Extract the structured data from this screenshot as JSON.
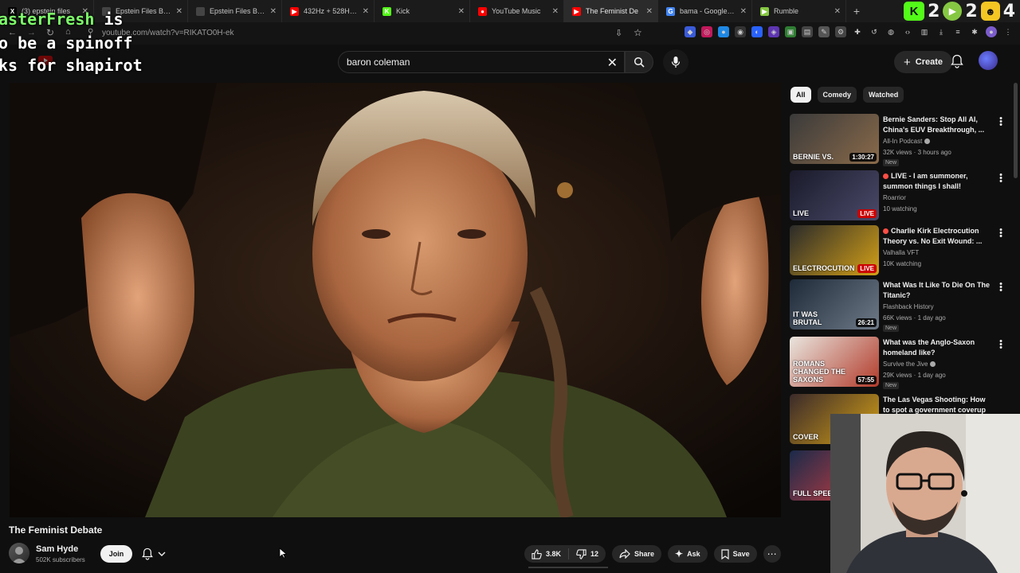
{
  "browser": {
    "tabs": [
      {
        "title": "(3) epstein files",
        "favicon": "x-icon",
        "color": "#000000",
        "glyph": "X"
      },
      {
        "title": "Epstein Files Browser",
        "favicon": "doc-icon",
        "color": "#444444",
        "glyph": ""
      },
      {
        "title": "Epstein Files Browser",
        "favicon": "doc-icon",
        "color": "#444444",
        "glyph": ""
      },
      {
        "title": "432Hz + 528Hz + 7",
        "favicon": "youtube-icon",
        "color": "#ff0000",
        "glyph": "▶"
      },
      {
        "title": "Kick",
        "favicon": "kick-icon",
        "color": "#53fc18",
        "glyph": "K"
      },
      {
        "title": "YouTube Music",
        "favicon": "youtube-music-icon",
        "color": "#ff0000",
        "glyph": "●"
      },
      {
        "title": "The Feminist De",
        "favicon": "youtube-icon",
        "color": "#ff0000",
        "glyph": "▶",
        "active": true
      },
      {
        "title": "bama - Google Sea",
        "favicon": "google-icon",
        "color": "#4285f4",
        "glyph": "G"
      },
      {
        "title": "Rumble",
        "favicon": "rumble-icon",
        "color": "#85c742",
        "glyph": "▶"
      }
    ],
    "url": "youtube.com/watch?v=RIKATO0H-ek",
    "right_badges": {
      "kick_letter": "K",
      "num1": "2",
      "num2": "2",
      "num3": "4"
    }
  },
  "overlay": {
    "line1_prefix": "asterFresh",
    "line1_suffix": " is",
    "line2": "o be a spinoff",
    "line3": "ks for shapirot"
  },
  "search": {
    "query": "baron coleman"
  },
  "header": {
    "create_label": "Create"
  },
  "video": {
    "title": "The Feminist Debate",
    "channel": "Sam Hyde",
    "subscribers": "502K subscribers",
    "join_label": "Join",
    "likes": "3.8K",
    "dislikes": "12",
    "share_label": "Share",
    "ask_label": "Ask",
    "save_label": "Save"
  },
  "chips": [
    "All",
    "Comedy",
    "Watched"
  ],
  "recommendations": [
    {
      "title": "Bernie Sanders: Stop All AI, China's EUV Breakthrough, ...",
      "channel": "All-In Podcast",
      "meta": "32K views · 3 hours ago",
      "badge": "New",
      "duration": "1:30:27",
      "thumb_text": "BERNIE VS.",
      "verified": true
    },
    {
      "title": "LIVE - I am summoner, summon things I shall!",
      "channel": "Roarrior",
      "meta": "10 watching",
      "badge": "",
      "duration": "LIVE",
      "thumb_text": "LIVE",
      "live": true
    },
    {
      "title": "Charlie Kirk Electrocution Theory vs. No Exit Wound: ...",
      "channel": "Valhalla VFT",
      "meta": "10K watching",
      "badge": "",
      "duration": "LIVE",
      "thumb_text": "ELECTROCUTION",
      "live": true
    },
    {
      "title": "What Was It Like To Die On The Titanic?",
      "channel": "Flashback History",
      "meta": "66K views · 1 day ago",
      "badge": "New",
      "duration": "26:21",
      "thumb_text": "IT WAS BRUTAL"
    },
    {
      "title": "What was the Anglo-Saxon homeland like?",
      "channel": "Survive the Jive",
      "meta": "29K views · 1 day ago",
      "badge": "New",
      "duration": "57:55",
      "thumb_text": "ROMANS CHANGED THE SAXONS",
      "verified": true
    },
    {
      "title": "The Las Vegas Shooting: How to spot a government coverup ...",
      "channel": "",
      "meta": "",
      "badge": "",
      "duration": "",
      "thumb_text": "COVER"
    },
    {
      "title": "",
      "channel": "",
      "meta": "",
      "badge": "",
      "duration": "",
      "thumb_text": "FULL SPEE"
    }
  ]
}
